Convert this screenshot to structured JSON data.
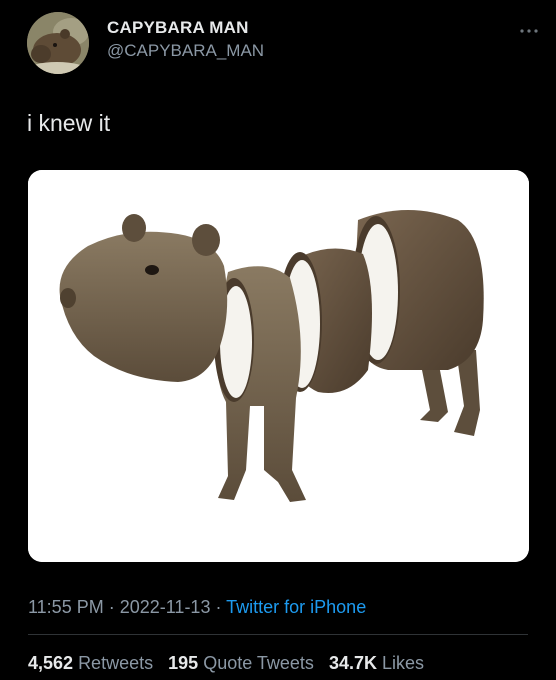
{
  "author": {
    "display_name": "CAPYBARA MAN",
    "handle": "@CAPYBARA_MAN",
    "avatar_icon": "capybara-avatar"
  },
  "more_icon": "ellipsis-icon",
  "tweet": {
    "text": "i knew it",
    "image_icon": "capybara-coconut-image"
  },
  "meta": {
    "time": "11:55 PM",
    "date": "2022-11-13",
    "separator": " · ",
    "source": "Twitter for iPhone"
  },
  "stats": {
    "retweets_count": "4,562",
    "retweets_label": "Retweets",
    "quotes_count": "195",
    "quotes_label": "Quote Tweets",
    "likes_count": "34.7K",
    "likes_label": "Likes"
  },
  "colors": {
    "background": "#000000",
    "text": "#e7e9ea",
    "secondary": "#8b98a5",
    "link": "#1d9bf0",
    "divider": "#2f3336"
  }
}
